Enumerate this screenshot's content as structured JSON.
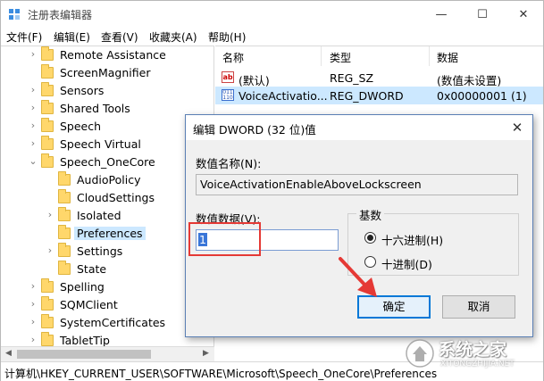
{
  "window": {
    "title": "注册表编辑器"
  },
  "titlebar": {
    "min_glyph": "—",
    "max_glyph": "☐",
    "close_glyph": "✕"
  },
  "menu": [
    "文件(F)",
    "编辑(E)",
    "查看(V)",
    "收藏夹(A)",
    "帮助(H)"
  ],
  "tree": {
    "items": [
      {
        "label": "Remote Assistance",
        "level": 2,
        "expandable": true
      },
      {
        "label": "ScreenMagnifier",
        "level": 2,
        "expandable": false
      },
      {
        "label": "Sensors",
        "level": 2,
        "expandable": true
      },
      {
        "label": "Shared Tools",
        "level": 2,
        "expandable": true
      },
      {
        "label": "Speech",
        "level": 2,
        "expandable": true
      },
      {
        "label": "Speech Virtual",
        "level": 2,
        "expandable": true
      },
      {
        "label": "Speech_OneCore",
        "level": 2,
        "expanded": true
      },
      {
        "label": "AudioPolicy",
        "level": 3,
        "expandable": false
      },
      {
        "label": "CloudSettings",
        "level": 3,
        "expandable": false
      },
      {
        "label": "Isolated",
        "level": 3,
        "expandable": true
      },
      {
        "label": "Preferences",
        "level": 3,
        "expandable": false,
        "selected": true
      },
      {
        "label": "Settings",
        "level": 3,
        "expandable": true
      },
      {
        "label": "State",
        "level": 3,
        "expandable": false
      },
      {
        "label": "Spelling",
        "level": 2,
        "expandable": true
      },
      {
        "label": "SQMClient",
        "level": 2,
        "expandable": true
      },
      {
        "label": "SystemCertificates",
        "level": 2,
        "expandable": true
      },
      {
        "label": "TabletTip",
        "level": 2,
        "expandable": true
      }
    ]
  },
  "values": {
    "headers": {
      "name": "名称",
      "type": "类型",
      "data": "数据"
    },
    "rows": [
      {
        "icon": "string-value-icon",
        "icon_text": "ab",
        "name": "(默认)",
        "type": "REG_SZ",
        "data": "(数值未设置)"
      },
      {
        "icon": "binary-value-icon",
        "icon_text": "011 110",
        "name": "VoiceActivatio...",
        "type": "REG_DWORD",
        "data": "0x00000001 (1)",
        "selected": true
      }
    ]
  },
  "status": {
    "path": "计算机\\HKEY_CURRENT_USER\\SOFTWARE\\Microsoft\\Speech_OneCore\\Preferences"
  },
  "dialog": {
    "title": "编辑 DWORD (32 位)值",
    "close_glyph": "✕",
    "name_label": "数值名称(N):",
    "name_value": "VoiceActivationEnableAboveLockscreen",
    "data_label": "数值数据(V):",
    "data_value": "1",
    "base_label": "基数",
    "radio_hex": "十六进制(H)",
    "radio_dec": "十进制(D)",
    "base_selected": "hex",
    "ok": "确定",
    "cancel": "取消"
  },
  "colors": {
    "highlight_box": "#e53935",
    "selection": "#cce8ff",
    "accent": "#0078d7"
  },
  "watermark": {
    "text": "系统之家",
    "sub": "XITONGZHIJIA.NET"
  }
}
